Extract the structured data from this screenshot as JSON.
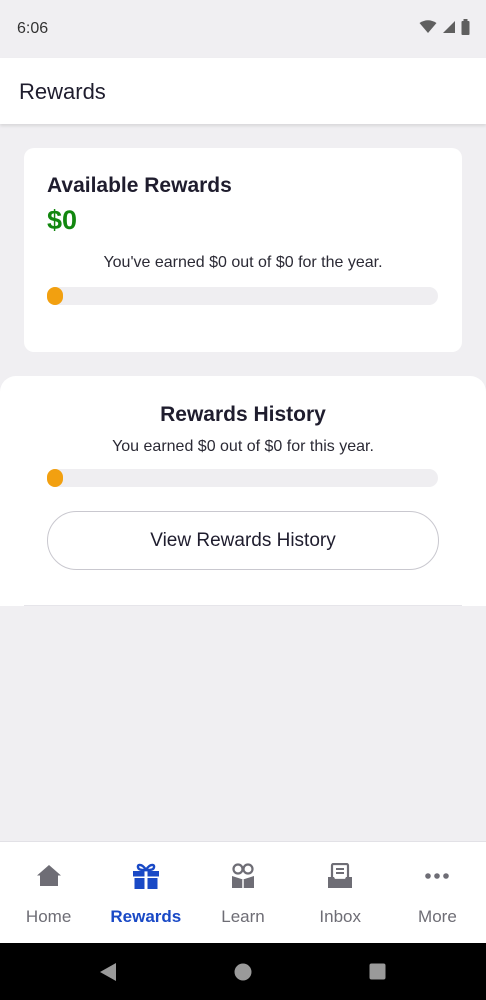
{
  "status_bar": {
    "time": "6:06"
  },
  "app_bar": {
    "title": "Rewards"
  },
  "available_rewards": {
    "title": "Available Rewards",
    "amount": "$0",
    "earned_text": "You've earned $0 out of $0 for the year.",
    "progress": 0
  },
  "rewards_history": {
    "title": "Rewards History",
    "earned_text": "You earned $0 out of $0 for this year.",
    "progress": 0,
    "button_label": "View Rewards History"
  },
  "bottom_nav": {
    "items": [
      {
        "label": "Home",
        "icon": "home-icon",
        "active": false
      },
      {
        "label": "Rewards",
        "icon": "gift-icon",
        "active": true
      },
      {
        "label": "Learn",
        "icon": "learn-icon",
        "active": false
      },
      {
        "label": "Inbox",
        "icon": "inbox-icon",
        "active": false
      },
      {
        "label": "More",
        "icon": "more-icon",
        "active": false
      }
    ]
  },
  "colors": {
    "accent": "#1949c6",
    "amount_green": "#12870f",
    "progress_orange": "#f2a010"
  }
}
